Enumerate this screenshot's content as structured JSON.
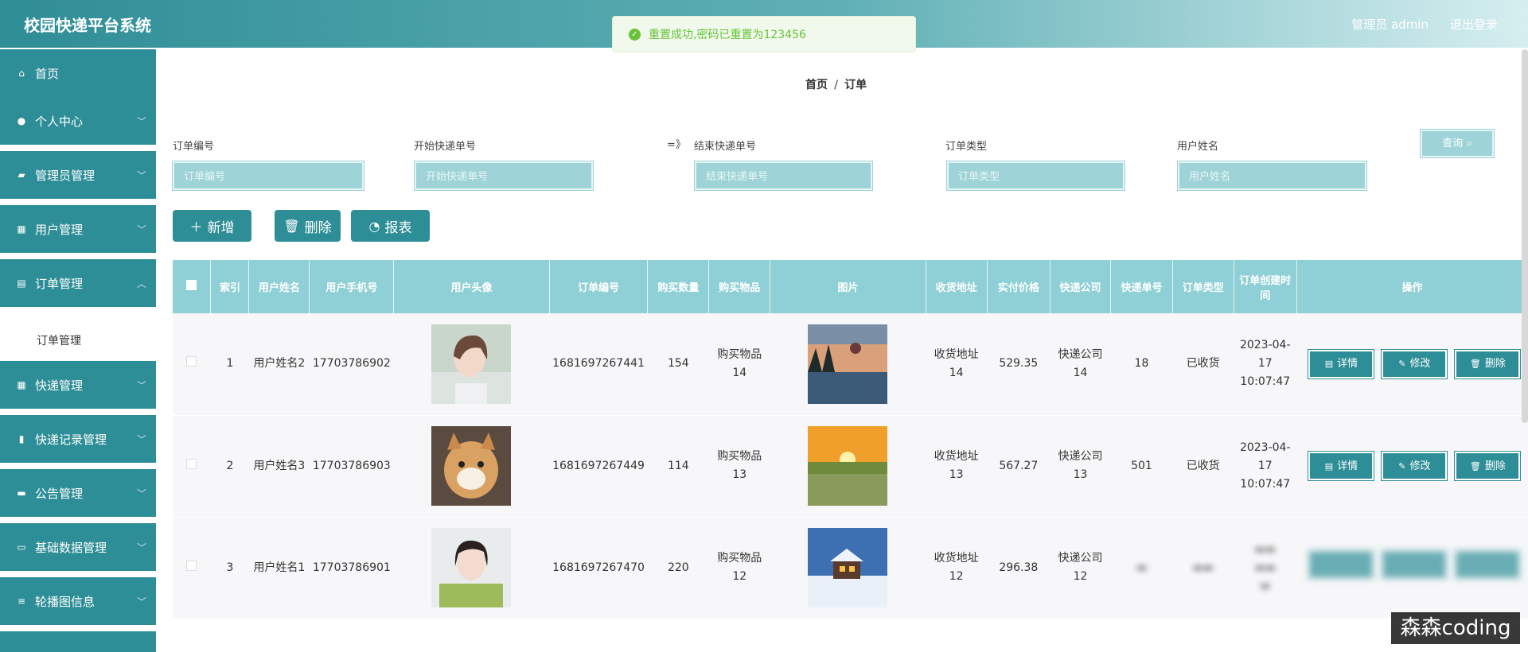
{
  "header": {
    "title": "校园快递平台系统",
    "admin": "管理员 admin",
    "logout": "退出登录"
  },
  "toast": {
    "icon": "check-circle-icon",
    "text": "重置成功,密码已重置为123456"
  },
  "sidebar": {
    "items": [
      {
        "label": "首页",
        "icon": "home-icon"
      },
      {
        "label": "个人中心",
        "icon": "user-icon"
      },
      {
        "label": "管理员管理",
        "icon": "chat-icon"
      },
      {
        "label": "用户管理",
        "icon": "grid-icon"
      },
      {
        "label": "订单管理",
        "icon": "bag-icon"
      },
      {
        "label": "快递管理",
        "icon": "grid-icon"
      },
      {
        "label": "快递记录管理",
        "icon": "clipboard-icon"
      },
      {
        "label": "公告管理",
        "icon": "message-icon"
      },
      {
        "label": "基础数据管理",
        "icon": "ticket-icon"
      },
      {
        "label": "轮播图信息",
        "icon": "sliders-icon"
      }
    ],
    "submenu": "订单管理"
  },
  "breadcrumb": {
    "home": "首页",
    "sep": "/",
    "current": "订单"
  },
  "filters": {
    "order_no": "订单编号",
    "start_express": "开始快递单号",
    "arrow": "=》",
    "end_express": "结束快递单号",
    "order_type": "订单类型",
    "user_name": "用户姓名",
    "query": "查询"
  },
  "actions": {
    "add": "新增",
    "delete": "删除",
    "report": "报表"
  },
  "table": {
    "headers": [
      "索引",
      "用户姓名",
      "用户手机号",
      "用户头像",
      "订单编号",
      "购买数量",
      "购买物品",
      "图片",
      "收货地址",
      "实付价格",
      "快递公司",
      "快递单号",
      "订单类型",
      "订单创建时间",
      "操作"
    ],
    "ops": {
      "detail": "详情",
      "edit": "修改",
      "delete": "删除"
    },
    "rows": [
      {
        "index": "1",
        "name": "用户姓名2",
        "phone": "17703786902",
        "order_no": "1681697267441",
        "qty": "154",
        "item": "购买物品14",
        "address": "收货地址14",
        "price": "529.35",
        "company": "快递公司14",
        "express_no": "18",
        "type": "已收货",
        "created": "2023-04-17 10:07:47"
      },
      {
        "index": "2",
        "name": "用户姓名3",
        "phone": "17703786903",
        "order_no": "1681697267449",
        "qty": "114",
        "item": "购买物品13",
        "address": "收货地址13",
        "price": "567.27",
        "company": "快递公司13",
        "express_no": "501",
        "type": "已收货",
        "created": "2023-04-17 10:07:47"
      },
      {
        "index": "3",
        "name": "用户姓名1",
        "phone": "17703786901",
        "order_no": "1681697267470",
        "qty": "220",
        "item": "购买物品12",
        "address": "收货地址12",
        "price": "296.38",
        "company": "快递公司12",
        "express_no": "",
        "type": "",
        "created": ""
      }
    ]
  },
  "watermark": "森森coding",
  "colors": {
    "primary": "#2e8e97",
    "header_bg": "#8fd0d6",
    "success": "#67c23a"
  }
}
